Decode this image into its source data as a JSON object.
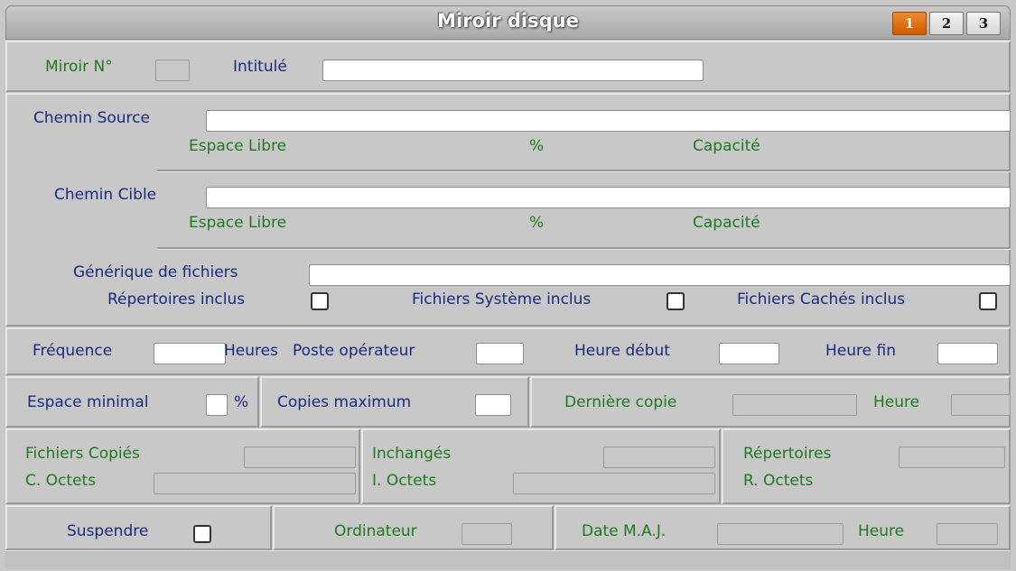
{
  "window": {
    "title": "Miroir disque"
  },
  "tabs": [
    "1",
    "2",
    "3"
  ],
  "header": {
    "miroir_label": "Miroir N°",
    "intitule_label": "Intitulé"
  },
  "source": {
    "label": "Chemin Source",
    "espace_libre": "Espace Libre",
    "percent": "%",
    "capacite": "Capacité"
  },
  "cible": {
    "label": "Chemin Cible",
    "espace_libre": "Espace Libre",
    "percent": "%",
    "capacite": "Capacité"
  },
  "fichiers": {
    "generique_label": "Générique de fichiers",
    "repertoires_inclus": "Répertoires inclus",
    "systeme_inclus": "Fichiers Système inclus",
    "caches_inclus": "Fichiers Cachés inclus"
  },
  "planning": {
    "frequence": "Fréquence",
    "heures": "Heures",
    "poste": "Poste opérateur",
    "heure_debut": "Heure début",
    "heure_fin": "Heure fin"
  },
  "espace": {
    "espace_minimal": "Espace minimal",
    "percent": "%",
    "copies_maximum": "Copies maximum",
    "derniere_copie": "Dernière copie",
    "heure": "Heure"
  },
  "stats": {
    "fichiers_copies": "Fichiers Copiés",
    "c_octets": "C. Octets",
    "inchanges": "Inchangés",
    "i_octets": "I. Octets",
    "repertoires": "Répertoires",
    "r_octets": "R. Octets"
  },
  "bottom": {
    "suspendre": "Suspendre",
    "ordinateur": "Ordinateur",
    "date_maj": "Date M.A.J.",
    "heure": "Heure"
  }
}
